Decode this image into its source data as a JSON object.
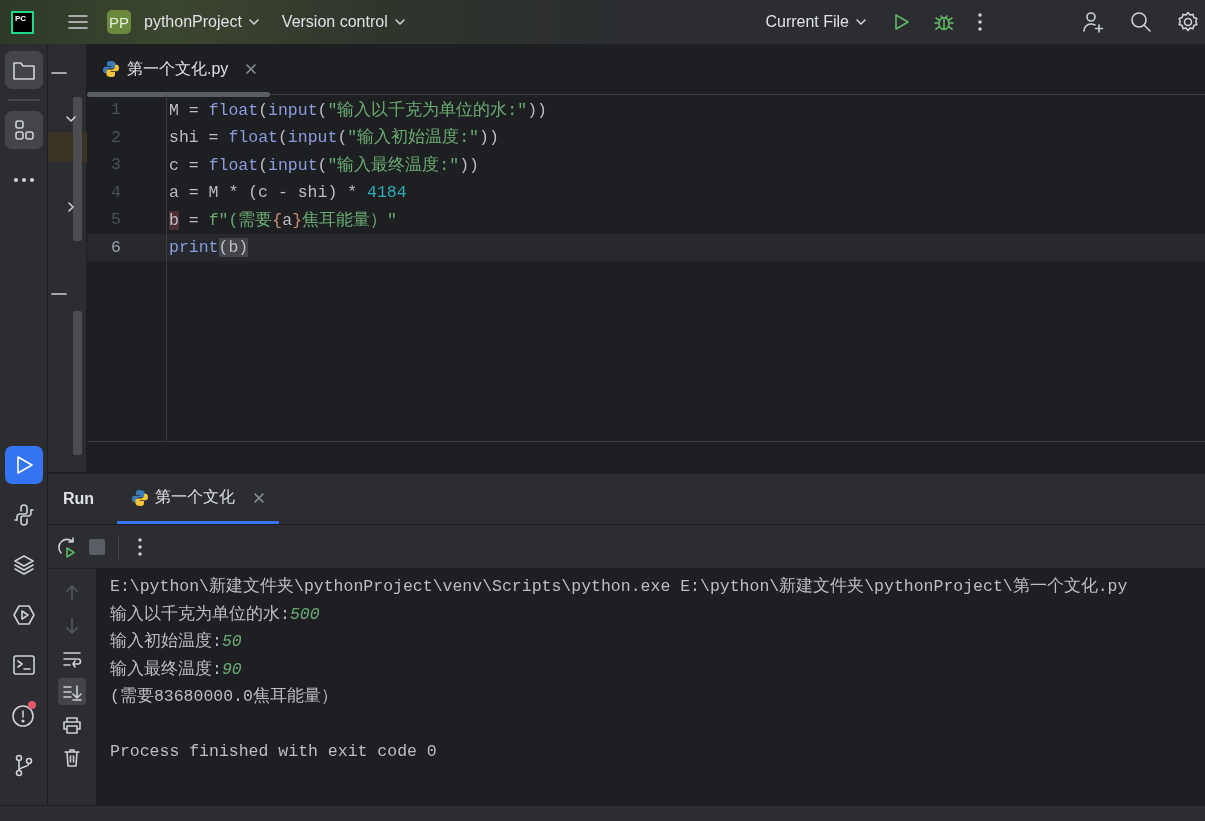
{
  "top_bar": {
    "logo_text": "PC",
    "project_badge": "PP",
    "project_name": "pythonProject",
    "vcs": "Version control",
    "run_config": "Current File"
  },
  "tool_strip": {
    "top": [
      {
        "kind": "folder",
        "selected": true,
        "alert": false
      },
      {
        "kind": "structure",
        "selected": true,
        "alert": false
      },
      {
        "kind": "more",
        "selected": false,
        "alert": false
      }
    ],
    "bottom": [
      {
        "kind": "run",
        "selected": true,
        "alert": false
      },
      {
        "kind": "python",
        "selected": false,
        "alert": false
      },
      {
        "kind": "layers",
        "selected": false,
        "alert": false
      },
      {
        "kind": "services",
        "selected": false,
        "alert": false
      },
      {
        "kind": "terminal",
        "selected": false,
        "alert": false
      },
      {
        "kind": "problems",
        "selected": false,
        "alert": true
      },
      {
        "kind": "git",
        "selected": false,
        "alert": false
      }
    ]
  },
  "editor": {
    "tabs": [
      {
        "label": "第一个文化.py",
        "selected": true
      }
    ],
    "lines": [
      {
        "number": "1",
        "current": false,
        "tokens": [
          {
            "text": "M",
            "kind": "plain"
          },
          {
            "text": " = ",
            "kind": "plain"
          },
          {
            "text": "float",
            "kind": "builtin"
          },
          {
            "text": "(",
            "kind": "plain"
          },
          {
            "text": "input",
            "kind": "builtin"
          },
          {
            "text": "(",
            "kind": "plain"
          },
          {
            "text": "\"输入以千克为单位的水:\"",
            "kind": "string"
          },
          {
            "text": "))",
            "kind": "plain"
          }
        ]
      },
      {
        "number": "2",
        "current": false,
        "tokens": [
          {
            "text": "shi",
            "kind": "plain"
          },
          {
            "text": " = ",
            "kind": "plain"
          },
          {
            "text": "float",
            "kind": "builtin"
          },
          {
            "text": "(",
            "kind": "plain"
          },
          {
            "text": "input",
            "kind": "builtin"
          },
          {
            "text": "(",
            "kind": "plain"
          },
          {
            "text": "\"输入初始温度:\"",
            "kind": "string"
          },
          {
            "text": "))",
            "kind": "plain"
          }
        ]
      },
      {
        "number": "3",
        "current": false,
        "tokens": [
          {
            "text": "c",
            "kind": "plain"
          },
          {
            "text": " = ",
            "kind": "plain"
          },
          {
            "text": "float",
            "kind": "builtin"
          },
          {
            "text": "(",
            "kind": "plain"
          },
          {
            "text": "input",
            "kind": "builtin"
          },
          {
            "text": "(",
            "kind": "plain"
          },
          {
            "text": "\"输入最终温度:\"",
            "kind": "string"
          },
          {
            "text": "))",
            "kind": "plain"
          }
        ]
      },
      {
        "number": "4",
        "current": false,
        "tokens": [
          {
            "text": "a = M * (c - shi) * ",
            "kind": "plain"
          },
          {
            "text": "4184",
            "kind": "number"
          }
        ]
      },
      {
        "number": "5",
        "current": false,
        "tokens": [
          {
            "text": "b",
            "kind": "marked"
          },
          {
            "text": " = ",
            "kind": "plain"
          },
          {
            "text": "f\"(需要",
            "kind": "string"
          },
          {
            "text": "{",
            "kind": "brace"
          },
          {
            "text": "a",
            "kind": "plain"
          },
          {
            "text": "}",
            "kind": "brace"
          },
          {
            "text": "焦耳能量）\"",
            "kind": "string"
          }
        ]
      },
      {
        "number": "6",
        "current": true,
        "tokens": [
          {
            "text": "print",
            "kind": "builtin"
          },
          {
            "text": "(",
            "kind": "matched"
          },
          {
            "text": "b",
            "kind": "matched"
          },
          {
            "text": ")",
            "kind": "matched"
          }
        ]
      }
    ]
  },
  "run_panel": {
    "title": "Run",
    "tabs": [
      {
        "label": "第一个文化",
        "selected": true
      }
    ],
    "toolbar": [
      {
        "kind": "rerun"
      },
      {
        "kind": "stop"
      },
      {
        "kind": "more"
      }
    ],
    "console_tools": [
      {
        "kind": "up",
        "selected": false,
        "disabled": true
      },
      {
        "kind": "down",
        "selected": false,
        "disabled": true
      },
      {
        "kind": "wrap",
        "selected": false,
        "disabled": false
      },
      {
        "kind": "scroll-end",
        "selected": true,
        "disabled": false
      },
      {
        "kind": "print",
        "selected": false,
        "disabled": false
      },
      {
        "kind": "trash",
        "selected": false,
        "disabled": false
      }
    ],
    "console": [
      {
        "kind": "text",
        "segments": [
          {
            "text": "E:\\python\\新建文件夹\\pythonProject\\venv\\Scripts\\python.exe E:\\python\\新建文件夹\\pythonProject\\第一个文化.py",
            "kind": "output"
          }
        ]
      },
      {
        "kind": "text",
        "segments": [
          {
            "text": "输入以千克为单位的水:",
            "kind": "output"
          },
          {
            "text": "500",
            "kind": "input"
          }
        ]
      },
      {
        "kind": "text",
        "segments": [
          {
            "text": "输入初始温度:",
            "kind": "output"
          },
          {
            "text": "50",
            "kind": "input"
          }
        ]
      },
      {
        "kind": "text",
        "segments": [
          {
            "text": "输入最终温度:",
            "kind": "output"
          },
          {
            "text": "90",
            "kind": "input"
          }
        ]
      },
      {
        "kind": "text",
        "segments": [
          {
            "text": "(需要83680000.0焦耳能量）",
            "kind": "output"
          }
        ]
      },
      {
        "kind": "blank"
      },
      {
        "kind": "text",
        "segments": [
          {
            "text": "Process finished with exit code 0",
            "kind": "output"
          }
        ]
      }
    ]
  }
}
